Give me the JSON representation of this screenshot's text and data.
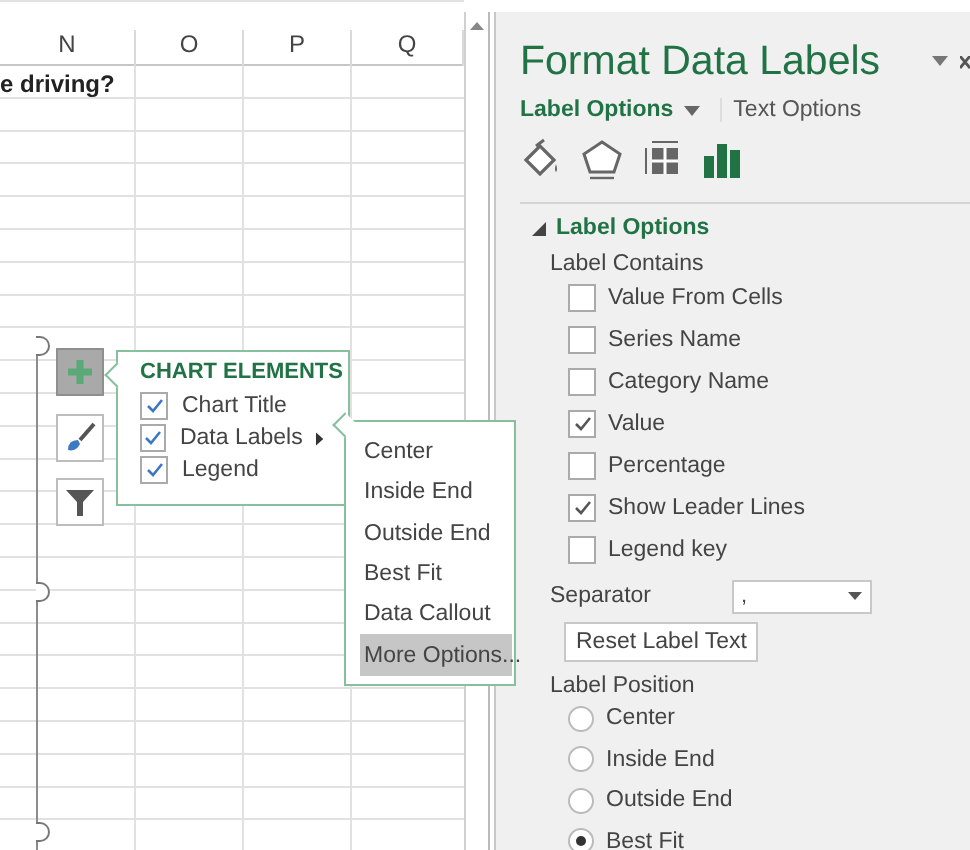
{
  "sheet": {
    "columns": [
      "N",
      "O",
      "P",
      "Q"
    ],
    "first_cell": "e driving?"
  },
  "chart_buttons": [
    {
      "kind": "add",
      "selected": true
    },
    {
      "kind": "style",
      "selected": false
    },
    {
      "kind": "filter",
      "selected": false
    }
  ],
  "chart_elements": {
    "title": "CHART ELEMENTS",
    "items": [
      {
        "label": "Chart Title",
        "checked": true,
        "submenu": false
      },
      {
        "label": "Data Labels",
        "checked": true,
        "submenu": true
      },
      {
        "label": "Legend",
        "checked": true,
        "submenu": false
      }
    ]
  },
  "submenu": {
    "items": [
      {
        "label": "Center",
        "selected": false
      },
      {
        "label": "Inside End",
        "selected": false
      },
      {
        "label": "Outside End",
        "selected": false
      },
      {
        "label": "Best Fit",
        "selected": false
      },
      {
        "label": "Data Callout",
        "selected": false
      },
      {
        "label": "More Options...",
        "selected": true
      }
    ]
  },
  "pane": {
    "title": "Format Data Labels",
    "tabs": [
      {
        "label": "Label Options",
        "selected": true,
        "dropdown": true
      },
      {
        "label": "Text Options",
        "selected": false,
        "dropdown": false
      }
    ],
    "icons": [
      {
        "kind": "fill",
        "selected": false
      },
      {
        "kind": "effects",
        "selected": false
      },
      {
        "kind": "size",
        "selected": false
      },
      {
        "kind": "options",
        "selected": true
      }
    ],
    "section": {
      "title": "Label Options",
      "expanded": true
    },
    "contains_label": "Label Contains",
    "checkboxes": [
      {
        "label": "Value From Cells",
        "checked": false
      },
      {
        "label": "Series Name",
        "checked": false
      },
      {
        "label": "Category Name",
        "checked": false
      },
      {
        "label": "Value",
        "checked": true
      },
      {
        "label": "Percentage",
        "checked": false
      },
      {
        "label": "Show Leader Lines",
        "checked": true
      },
      {
        "label": "Legend key",
        "checked": false
      }
    ],
    "separator": {
      "label": "Separator",
      "value": ","
    },
    "reset_button": "Reset Label Text",
    "position_label": "Label Position",
    "positions": [
      {
        "label": "Center",
        "selected": false
      },
      {
        "label": "Inside End",
        "selected": false
      },
      {
        "label": "Outside End",
        "selected": false
      },
      {
        "label": "Best Fit",
        "selected": true
      }
    ]
  }
}
